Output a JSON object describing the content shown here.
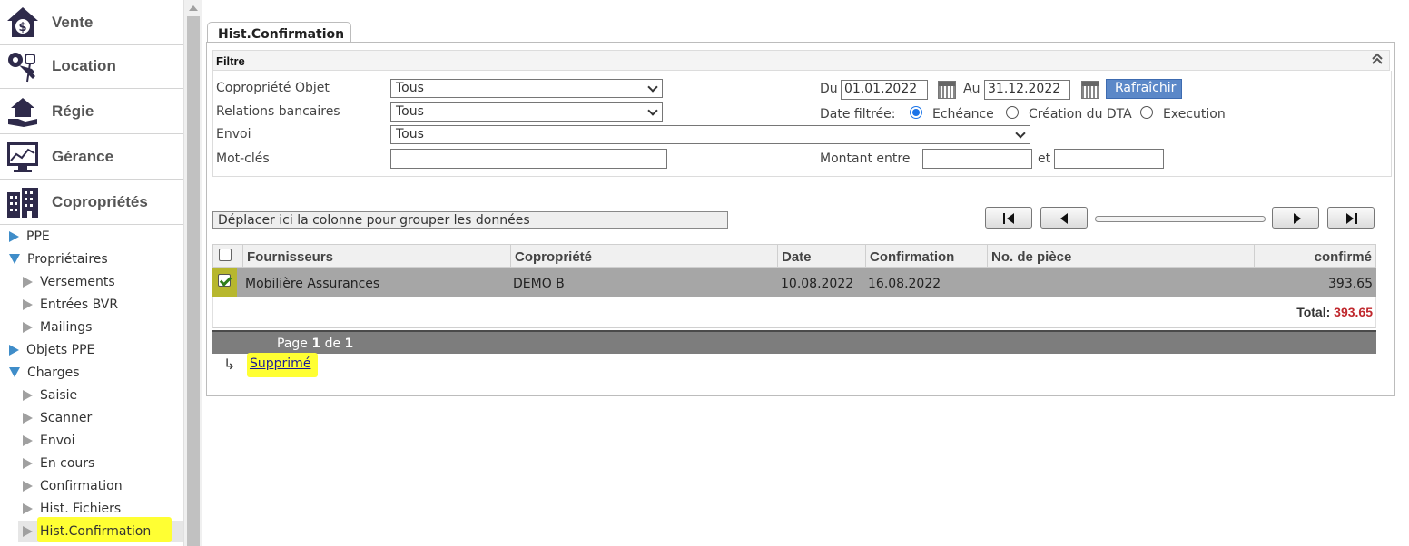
{
  "sidebar": {
    "modules": [
      {
        "label": "Vente",
        "icon": "house-dollar-icon"
      },
      {
        "label": "Location",
        "icon": "keys-icon"
      },
      {
        "label": "Régie",
        "icon": "hand-house-icon"
      },
      {
        "label": "Gérance",
        "icon": "building-chart-icon"
      },
      {
        "label": "Copropriétés",
        "icon": "buildings-icon"
      }
    ],
    "tree": [
      {
        "label": "PPE",
        "level": 0,
        "state": "collapsed"
      },
      {
        "label": "Propriétaires",
        "level": 0,
        "state": "expanded"
      },
      {
        "label": "Versements",
        "level": 1,
        "state": "leaf"
      },
      {
        "label": "Entrées BVR",
        "level": 1,
        "state": "leaf"
      },
      {
        "label": "Mailings",
        "level": 1,
        "state": "leaf"
      },
      {
        "label": "Objets PPE",
        "level": 0,
        "state": "collapsed"
      },
      {
        "label": "Charges",
        "level": 0,
        "state": "expanded"
      },
      {
        "label": "Saisie",
        "level": 1,
        "state": "leaf"
      },
      {
        "label": "Scanner",
        "level": 1,
        "state": "leaf"
      },
      {
        "label": "Envoi",
        "level": 1,
        "state": "leaf"
      },
      {
        "label": "En cours",
        "level": 1,
        "state": "leaf"
      },
      {
        "label": "Confirmation",
        "level": 1,
        "state": "leaf"
      },
      {
        "label": "Hist. Fichiers",
        "level": 1,
        "state": "leaf"
      },
      {
        "label": "Hist.Confirmation",
        "level": 1,
        "state": "selected"
      }
    ]
  },
  "tab": {
    "label": "Hist.Confirmation"
  },
  "filter": {
    "title": "Filtre",
    "copropriete_label": "Copropriété Objet",
    "copropriete_value": "Tous",
    "relations_label": "Relations bancaires",
    "relations_value": "Tous",
    "envoi_label": "Envoi",
    "envoi_value": "Tous",
    "motcles_label": "Mot-clés",
    "motcles_value": "",
    "du_label": "Du",
    "du_value": "01.01.2022",
    "au_label": "Au",
    "au_value": "31.12.2022",
    "refresh_label": "Rafraîchir",
    "date_filtree_label": "Date filtrée:",
    "radio_echeance": "Echéance",
    "radio_creation": "Création du DTA",
    "radio_execution": "Execution",
    "selected_radio": "Echéance",
    "montant_label": "Montant entre",
    "montant_min": "",
    "et_label": "et",
    "montant_max": ""
  },
  "grouping": {
    "placeholder": "Déplacer ici la colonne pour grouper les données"
  },
  "grid": {
    "columns": [
      "Fournisseurs",
      "Copropriété",
      "Date",
      "Confirmation",
      "No. de pièce",
      "confirmé"
    ],
    "rows": [
      {
        "checked": true,
        "fournisseur": "Mobilière Assurances",
        "copropriete": "DEMO B",
        "date": "10.08.2022",
        "confirmation": "16.08.2022",
        "no_piece": "",
        "confirme": "393.65"
      }
    ],
    "total_label": "Total:",
    "total_value": "393.65",
    "total_color": "#c0282d"
  },
  "pager": {
    "page_word": "Page",
    "current": "1",
    "of_word": "de",
    "total": "1"
  },
  "actions": {
    "delete_label": "Supprimé"
  },
  "colors": {
    "accent": "#3f8dc9",
    "button": "#5b88c8",
    "highlight": "#ffff33"
  }
}
